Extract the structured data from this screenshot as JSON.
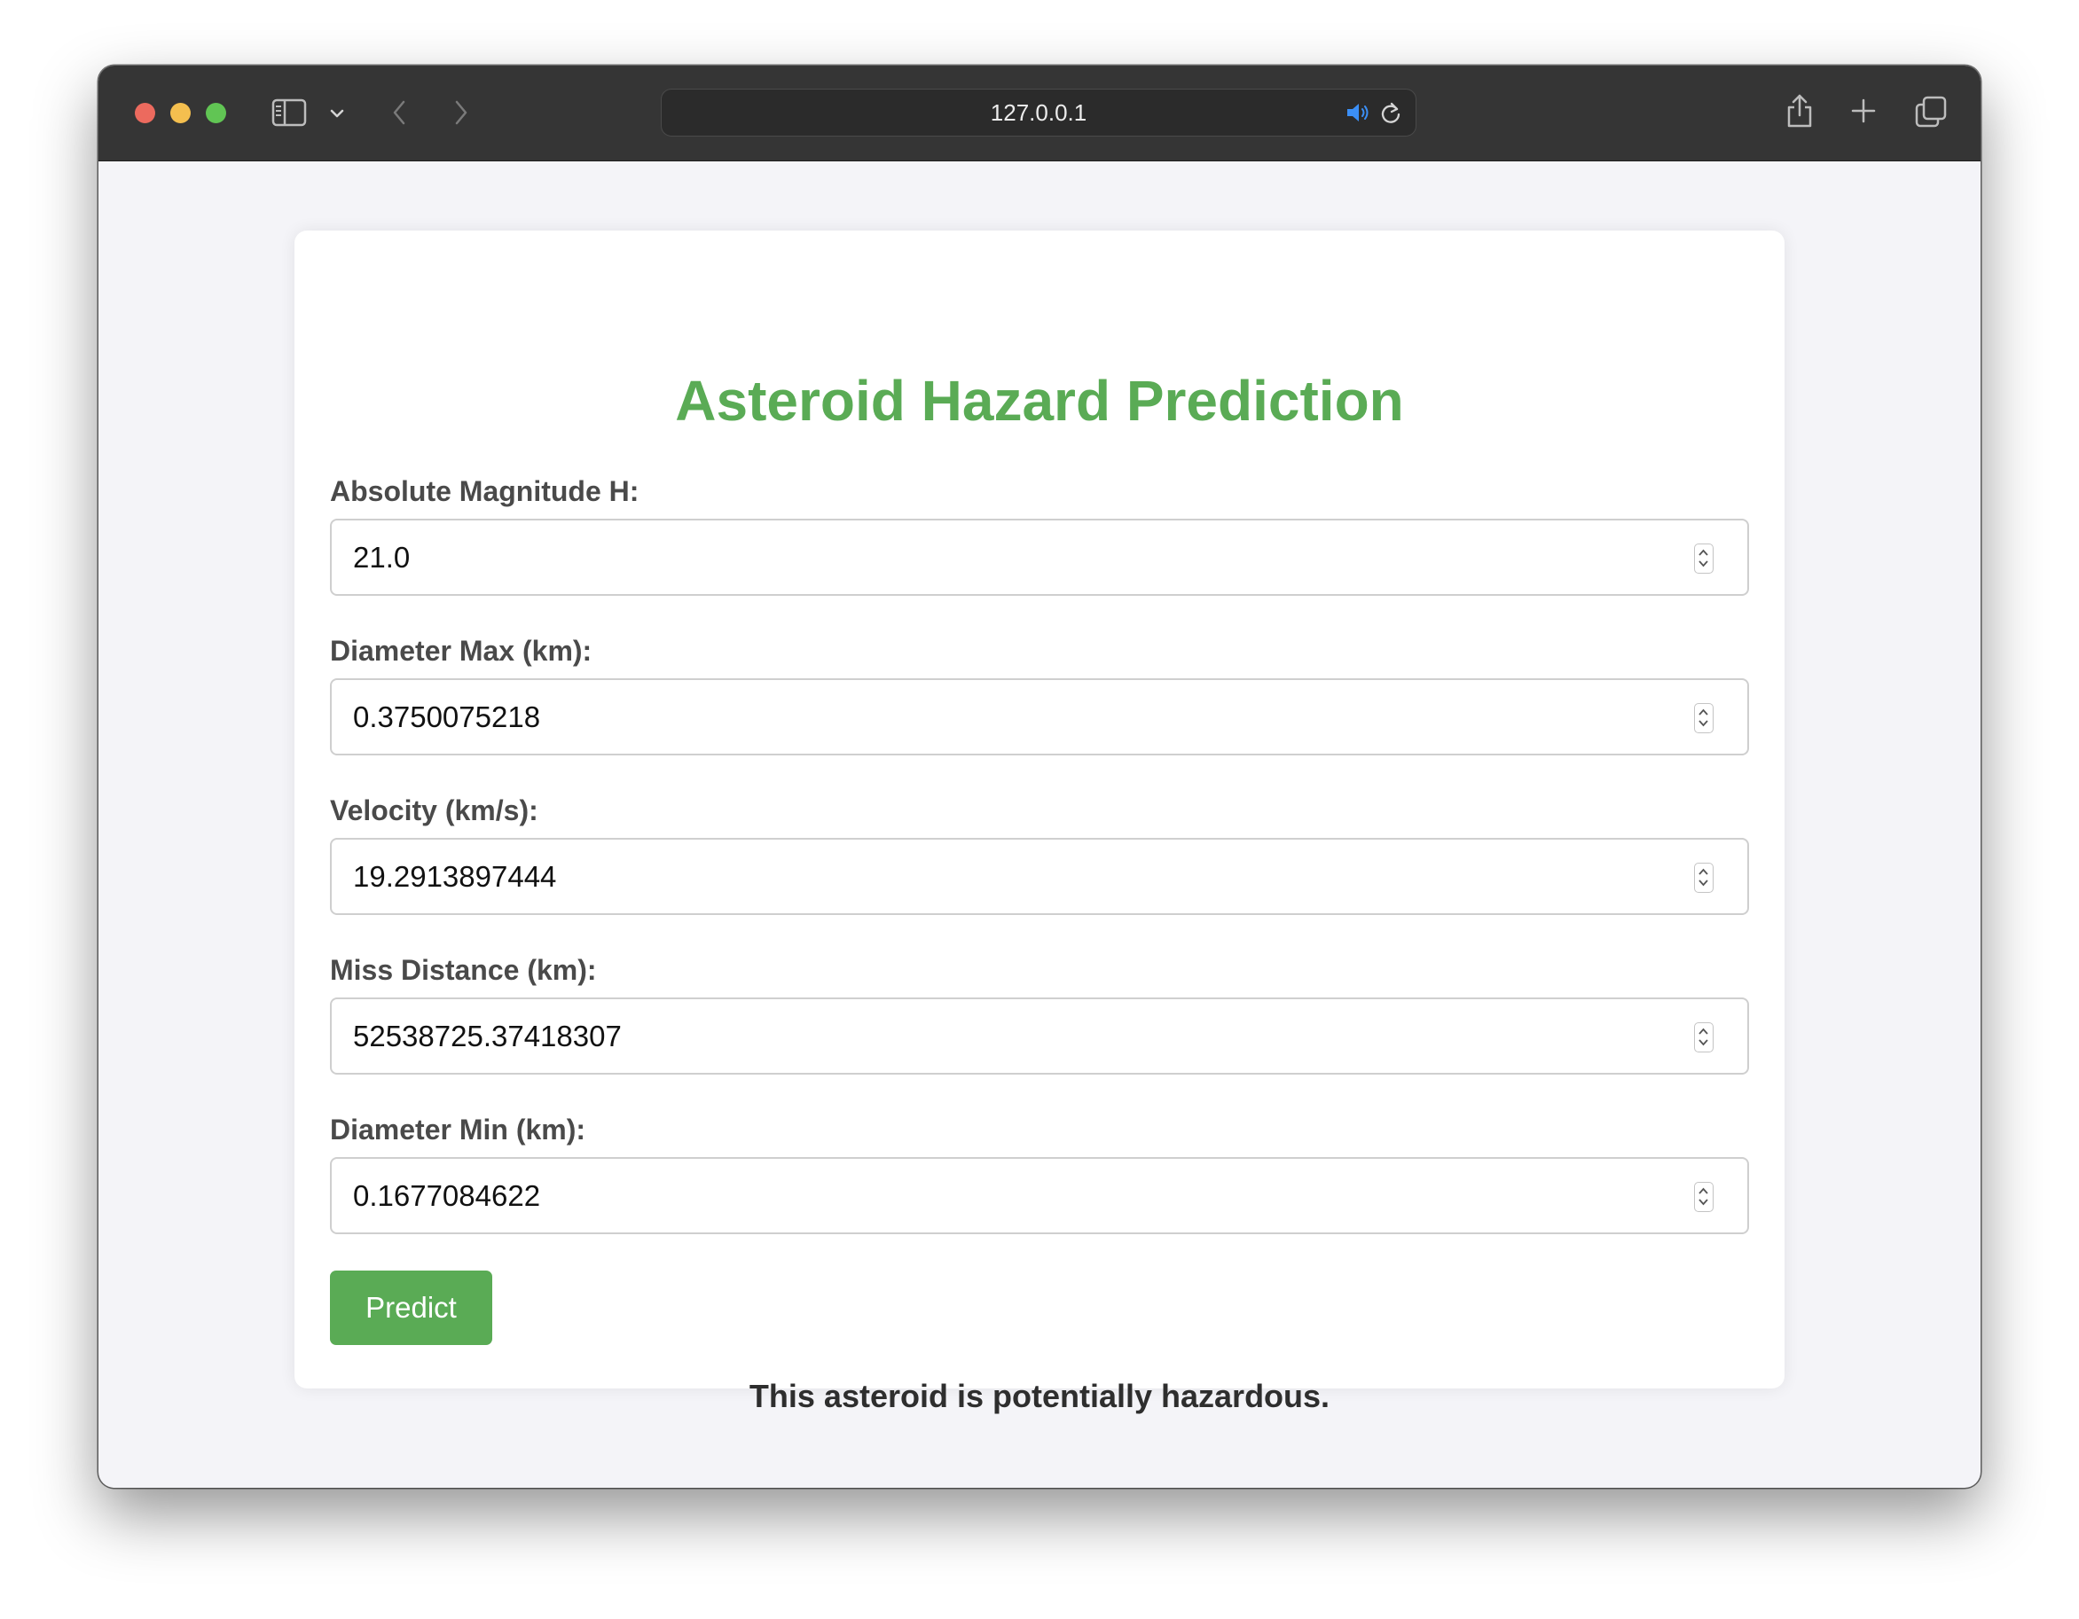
{
  "browser": {
    "url": "127.0.0.1",
    "traffic_light_colors": {
      "close": "#ec6a5e",
      "minimize": "#f4bf4f",
      "zoom": "#61c554"
    },
    "icons": [
      "sidebar-icon",
      "chevron-down-icon",
      "back-icon",
      "forward-icon",
      "audio-icon",
      "reload-icon",
      "share-icon",
      "new-tab-icon",
      "tabs-overview-icon"
    ]
  },
  "form": {
    "title": "Asteroid Hazard Prediction",
    "fields": [
      {
        "label": "Absolute Magnitude H:",
        "value": "21.0"
      },
      {
        "label": "Diameter Max (km):",
        "value": "0.3750075218"
      },
      {
        "label": "Velocity (km/s):",
        "value": "19.2913897444"
      },
      {
        "label": "Miss Distance (km):",
        "value": "52538725.37418307"
      },
      {
        "label": "Diameter Min (km):",
        "value": "0.1677084622"
      }
    ],
    "submit_label": "Predict",
    "result_text": "This asteroid is potentially hazardous."
  },
  "colors": {
    "accent": "#5aab55",
    "page_background": "#f4f4f8",
    "titlebar": "#353535"
  }
}
